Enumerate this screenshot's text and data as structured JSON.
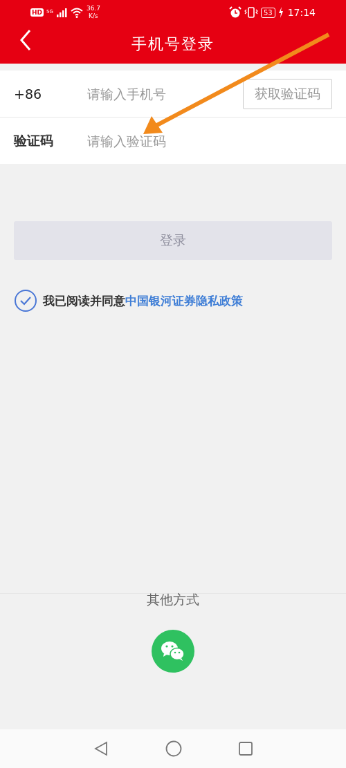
{
  "status_bar": {
    "hd": "HD",
    "network": "5G",
    "speed": "36.7",
    "speed_unit": "K/s",
    "battery": "53",
    "time": "17:14"
  },
  "header": {
    "title": "手机号登录"
  },
  "phone_row": {
    "prefix": "+86",
    "placeholder": "请输入手机号",
    "code_button": "获取验证码"
  },
  "code_row": {
    "label": "验证码",
    "placeholder": "请输入验证码"
  },
  "login_button": {
    "label": "登录",
    "disabled": true
  },
  "agreement": {
    "checked": true,
    "text": "我已阅读并同意",
    "link": "中国银河证券隐私政策"
  },
  "other_methods": {
    "title": "其他方式"
  }
}
